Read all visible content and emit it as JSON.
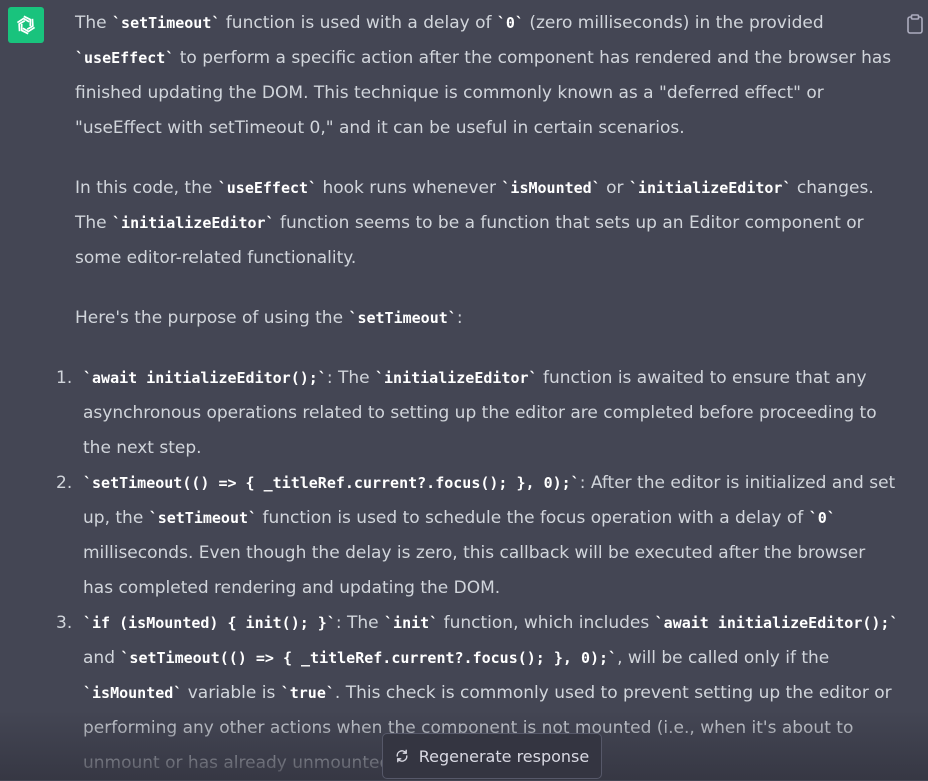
{
  "response": {
    "paragraph_1": [
      {
        "t": "text",
        "v": "The "
      },
      {
        "t": "code",
        "v": "`setTimeout`"
      },
      {
        "t": "text",
        "v": " function is used with a delay of "
      },
      {
        "t": "code",
        "v": "`0`"
      },
      {
        "t": "text",
        "v": " (zero milliseconds) in the provided "
      },
      {
        "t": "code",
        "v": "`useEffect`"
      },
      {
        "t": "text",
        "v": " to perform a specific action after the component has rendered and the browser has finished updating the DOM. This technique is commonly known as a \"deferred effect\" or \"useEffect with setTimeout 0,\" and it can be useful in certain scenarios."
      }
    ],
    "paragraph_2": [
      {
        "t": "text",
        "v": "In this code, the "
      },
      {
        "t": "code",
        "v": "`useEffect`"
      },
      {
        "t": "text",
        "v": " hook runs whenever "
      },
      {
        "t": "code",
        "v": "`isMounted`"
      },
      {
        "t": "text",
        "v": " or "
      },
      {
        "t": "code",
        "v": "`initializeEditor`"
      },
      {
        "t": "text",
        "v": " changes. The "
      },
      {
        "t": "code",
        "v": "`initializeEditor`"
      },
      {
        "t": "text",
        "v": " function seems to be a function that sets up an Editor component or some editor-related functionality."
      }
    ],
    "paragraph_3": [
      {
        "t": "text",
        "v": "Here's the purpose of using the "
      },
      {
        "t": "code",
        "v": "`setTimeout`"
      },
      {
        "t": "text",
        "v": ":"
      }
    ],
    "list_items": [
      {
        "number": "1.",
        "segments": [
          {
            "t": "code",
            "v": "`await initializeEditor();`"
          },
          {
            "t": "text",
            "v": ": The "
          },
          {
            "t": "code",
            "v": "`initializeEditor`"
          },
          {
            "t": "text",
            "v": " function is awaited to ensure that any asynchronous operations related to setting up the editor are completed before proceeding to the next step."
          }
        ]
      },
      {
        "number": "2.",
        "segments": [
          {
            "t": "code",
            "v": "`setTimeout(() => { _titleRef.current?.focus(); }, 0);`"
          },
          {
            "t": "text",
            "v": ": After the editor is initialized and set up, the "
          },
          {
            "t": "code",
            "v": "`setTimeout`"
          },
          {
            "t": "text",
            "v": " function is used to schedule the focus operation with a delay of "
          },
          {
            "t": "code",
            "v": "`0`"
          },
          {
            "t": "text",
            "v": " milliseconds. Even though the delay is zero, this callback will be executed after the browser has completed rendering and updating the DOM."
          }
        ]
      },
      {
        "number": "3.",
        "segments": [
          {
            "t": "code",
            "v": "`if (isMounted) { init(); }`"
          },
          {
            "t": "text",
            "v": ": The "
          },
          {
            "t": "code",
            "v": "`init`"
          },
          {
            "t": "text",
            "v": " function, which includes "
          },
          {
            "t": "code",
            "v": "`await initializeEditor();`"
          },
          {
            "t": "text",
            "v": " and "
          },
          {
            "t": "code",
            "v": "`setTimeout(() => { _titleRef.current?.focus(); }, 0);`"
          },
          {
            "t": "text",
            "v": ", will be called only if the "
          },
          {
            "t": "code",
            "v": "`isMounted`"
          },
          {
            "t": "text",
            "v": " variable is "
          },
          {
            "t": "code",
            "v": "`true`"
          },
          {
            "t": "text",
            "v": ". This check is commonly used to prevent setting up the editor or performing any other actions when the component is not mounted (i.e., when it's about to unmount or has already unmounted)."
          }
        ]
      }
    ]
  },
  "regenerate_button": {
    "label": "Regenerate response"
  },
  "icons": {
    "avatar": "openai-logo-icon",
    "copy": "clipboard-icon",
    "regenerate": "refresh-icon"
  },
  "colors": {
    "avatar_bg": "#19c37d",
    "background": "#444654",
    "text": "#d1d5db",
    "code": "#ffffff"
  }
}
